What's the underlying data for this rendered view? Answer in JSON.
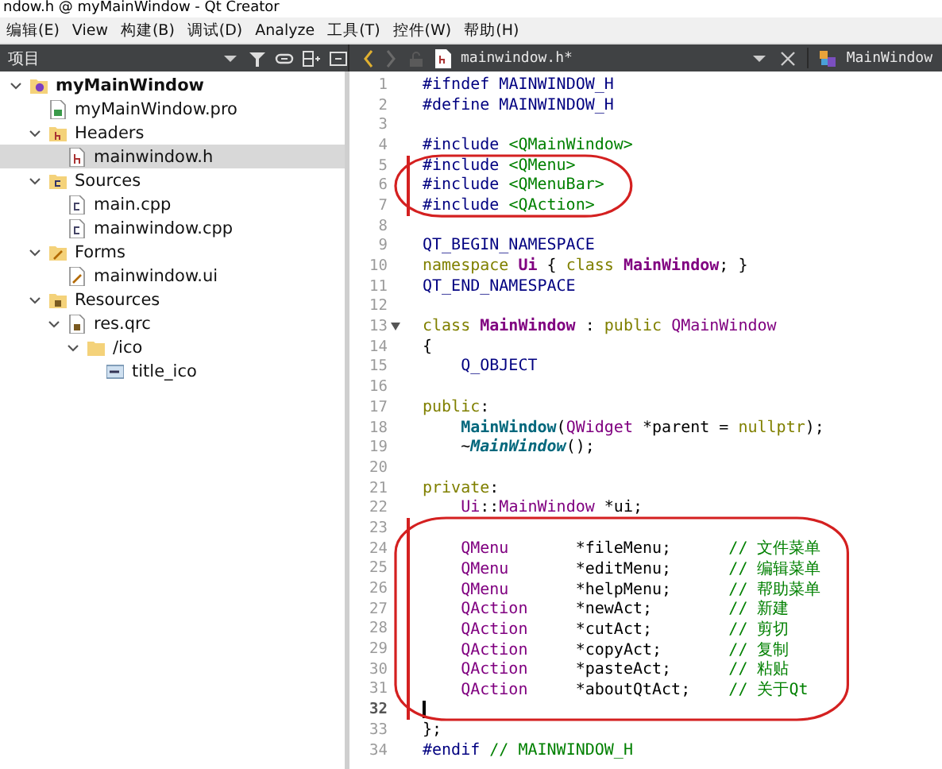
{
  "window": {
    "title": "ndow.h @ myMainWindow - Qt Creator"
  },
  "menu_bar": [
    "编辑(E)",
    "View",
    "构建(B)",
    "调试(D)",
    "Analyze",
    "工具(T)",
    "控件(W)",
    "帮助(H)"
  ],
  "toolbar": {
    "panel_title": "项目",
    "back_enabled": true,
    "forward_enabled": false,
    "file_tab": "mainwindow.h*",
    "symbol": "MainWindow"
  },
  "project_tree": [
    {
      "label": "myMainWindow",
      "kind": "project",
      "expanded": true,
      "selected": false,
      "children": [
        {
          "label": "myMainWindow.pro",
          "kind": "pro",
          "selected": false
        },
        {
          "label": "Headers",
          "kind": "header-folder",
          "expanded": true,
          "selected": false,
          "children": [
            {
              "label": "mainwindow.h",
              "kind": "header",
              "selected": true
            }
          ]
        },
        {
          "label": "Sources",
          "kind": "source-folder",
          "expanded": true,
          "selected": false,
          "children": [
            {
              "label": "main.cpp",
              "kind": "source",
              "selected": false
            },
            {
              "label": "mainwindow.cpp",
              "kind": "source",
              "selected": false
            }
          ]
        },
        {
          "label": "Forms",
          "kind": "form-folder",
          "expanded": true,
          "selected": false,
          "children": [
            {
              "label": "mainwindow.ui",
              "kind": "form",
              "selected": false
            }
          ]
        },
        {
          "label": "Resources",
          "kind": "resource-folder",
          "expanded": true,
          "selected": false,
          "children": [
            {
              "label": "res.qrc",
              "kind": "qrc",
              "expanded": true,
              "selected": false,
              "children": [
                {
                  "label": "/ico",
                  "kind": "folder",
                  "expanded": true,
                  "selected": false,
                  "children": [
                    {
                      "label": "title_ico",
                      "kind": "image",
                      "selected": false
                    }
                  ]
                }
              ]
            }
          ]
        }
      ]
    }
  ],
  "code_blocks": [
    {
      "changed": false,
      "circled": false,
      "lines": [
        {
          "number": "1",
          "tokens": [
            {
              "kind": "pre",
              "text": "#ifndef "
            },
            {
              "kind": "mac",
              "text": "MAINWINDOW_H"
            }
          ]
        },
        {
          "number": "2",
          "tokens": [
            {
              "kind": "pre",
              "text": "#define "
            },
            {
              "kind": "mac",
              "text": "MAINWINDOW_H"
            }
          ]
        },
        {
          "number": "3"
        },
        {
          "number": "4",
          "tokens": [
            {
              "kind": "pre",
              "text": "#include "
            },
            {
              "kind": "str",
              "text": "<QMainWindow>"
            }
          ]
        }
      ]
    },
    {
      "changed": true,
      "circled": true,
      "lines": [
        {
          "number": "5",
          "tokens": [
            {
              "kind": "pre",
              "text": "#include "
            },
            {
              "kind": "str",
              "text": "<QMenu>"
            }
          ]
        },
        {
          "number": "6",
          "tokens": [
            {
              "kind": "pre",
              "text": "#include "
            },
            {
              "kind": "str",
              "text": "<QMenuBar>"
            }
          ]
        },
        {
          "number": "7",
          "tokens": [
            {
              "kind": "pre",
              "text": "#include "
            },
            {
              "kind": "str",
              "text": "<QAction>"
            }
          ]
        }
      ]
    },
    {
      "changed": false,
      "circled": false,
      "lines": [
        {
          "number": "8"
        },
        {
          "number": "9",
          "tokens": [
            {
              "kind": "mac",
              "text": "QT_BEGIN_NAMESPACE"
            }
          ]
        },
        {
          "number": "10",
          "tokens": [
            {
              "kind": "kw",
              "text": "namespace "
            },
            {
              "kind": "typeb",
              "text": "Ui"
            },
            {
              "kind": "p",
              "text": " { "
            },
            {
              "kind": "kw",
              "text": "class "
            },
            {
              "kind": "typeb",
              "text": "MainWindow"
            },
            {
              "kind": "p",
              "text": "; }"
            }
          ]
        },
        {
          "number": "11",
          "tokens": [
            {
              "kind": "mac",
              "text": "QT_END_NAMESPACE"
            }
          ]
        },
        {
          "number": "12"
        },
        {
          "number": "13",
          "foldable": true,
          "tokens": [
            {
              "kind": "kw",
              "text": "class "
            },
            {
              "kind": "typeb",
              "text": "MainWindow"
            },
            {
              "kind": "p",
              "text": " : "
            },
            {
              "kind": "kw",
              "text": "public "
            },
            {
              "kind": "type",
              "text": "QMainWindow"
            }
          ]
        },
        {
          "number": "14",
          "tokens": [
            {
              "kind": "p",
              "text": "{"
            }
          ]
        },
        {
          "number": "15",
          "tokens": [
            {
              "kind": "mac",
              "text": "    Q_OBJECT"
            }
          ]
        },
        {
          "number": "16"
        },
        {
          "number": "17",
          "tokens": [
            {
              "kind": "kw",
              "text": "public"
            },
            {
              "kind": "p",
              "text": ":"
            }
          ]
        },
        {
          "number": "18",
          "tokens": [
            {
              "kind": "fn",
              "text": "    MainWindow"
            },
            {
              "kind": "p",
              "text": "("
            },
            {
              "kind": "type",
              "text": "QWidget"
            },
            {
              "kind": "p",
              "text": " *parent = "
            },
            {
              "kind": "kw",
              "text": "nullptr"
            },
            {
              "kind": "p",
              "text": ");"
            }
          ]
        },
        {
          "number": "19",
          "tokens": [
            {
              "kind": "p",
              "text": "    ~"
            },
            {
              "kind": "fni",
              "text": "MainWindow"
            },
            {
              "kind": "p",
              "text": "();"
            }
          ]
        },
        {
          "number": "20"
        },
        {
          "number": "21",
          "tokens": [
            {
              "kind": "kw",
              "text": "private"
            },
            {
              "kind": "p",
              "text": ":"
            }
          ]
        },
        {
          "number": "22",
          "tokens": [
            {
              "kind": "type",
              "text": "    Ui"
            },
            {
              "kind": "p",
              "text": "::"
            },
            {
              "kind": "type",
              "text": "MainWindow"
            },
            {
              "kind": "p",
              "text": " *ui;"
            }
          ]
        }
      ]
    },
    {
      "changed": true,
      "circled": true,
      "lines": [
        {
          "number": "23"
        },
        {
          "number": "24",
          "tokens": [
            {
              "kind": "type",
              "text": "    QMenu"
            },
            {
              "kind": "p",
              "text": "       *fileMenu;      "
            },
            {
              "kind": "cm",
              "text": "// 文件菜单"
            }
          ]
        },
        {
          "number": "25",
          "tokens": [
            {
              "kind": "type",
              "text": "    QMenu"
            },
            {
              "kind": "p",
              "text": "       *editMenu;      "
            },
            {
              "kind": "cm",
              "text": "// 编辑菜单"
            }
          ]
        },
        {
          "number": "26",
          "tokens": [
            {
              "kind": "type",
              "text": "    QMenu"
            },
            {
              "kind": "p",
              "text": "       *helpMenu;      "
            },
            {
              "kind": "cm",
              "text": "// 帮助菜单"
            }
          ]
        },
        {
          "number": "27",
          "tokens": [
            {
              "kind": "type",
              "text": "    QAction"
            },
            {
              "kind": "p",
              "text": "     *newAct;        "
            },
            {
              "kind": "cm",
              "text": "// 新建"
            }
          ]
        },
        {
          "number": "28",
          "tokens": [
            {
              "kind": "type",
              "text": "    QAction"
            },
            {
              "kind": "p",
              "text": "     *cutAct;        "
            },
            {
              "kind": "cm",
              "text": "// 剪切"
            }
          ]
        },
        {
          "number": "29",
          "tokens": [
            {
              "kind": "type",
              "text": "    QAction"
            },
            {
              "kind": "p",
              "text": "     *copyAct;       "
            },
            {
              "kind": "cm",
              "text": "// 复制"
            }
          ]
        },
        {
          "number": "30",
          "tokens": [
            {
              "kind": "type",
              "text": "    QAction"
            },
            {
              "kind": "p",
              "text": "     *pasteAct;      "
            },
            {
              "kind": "cm",
              "text": "// 粘贴"
            }
          ]
        },
        {
          "number": "31",
          "tokens": [
            {
              "kind": "type",
              "text": "    QAction"
            },
            {
              "kind": "p",
              "text": "     *aboutQtAct;    "
            },
            {
              "kind": "cm",
              "text": "// 关于Qt"
            }
          ]
        },
        {
          "number": "32",
          "current": true
        }
      ]
    },
    {
      "changed": false,
      "circled": false,
      "lines": [
        {
          "number": "33",
          "tokens": [
            {
              "kind": "p",
              "text": "};"
            }
          ]
        },
        {
          "number": "34",
          "tokens": [
            {
              "kind": "pre",
              "text": "#endif "
            },
            {
              "kind": "cm",
              "text": "// MAINWINDOW_H"
            }
          ]
        }
      ]
    }
  ]
}
